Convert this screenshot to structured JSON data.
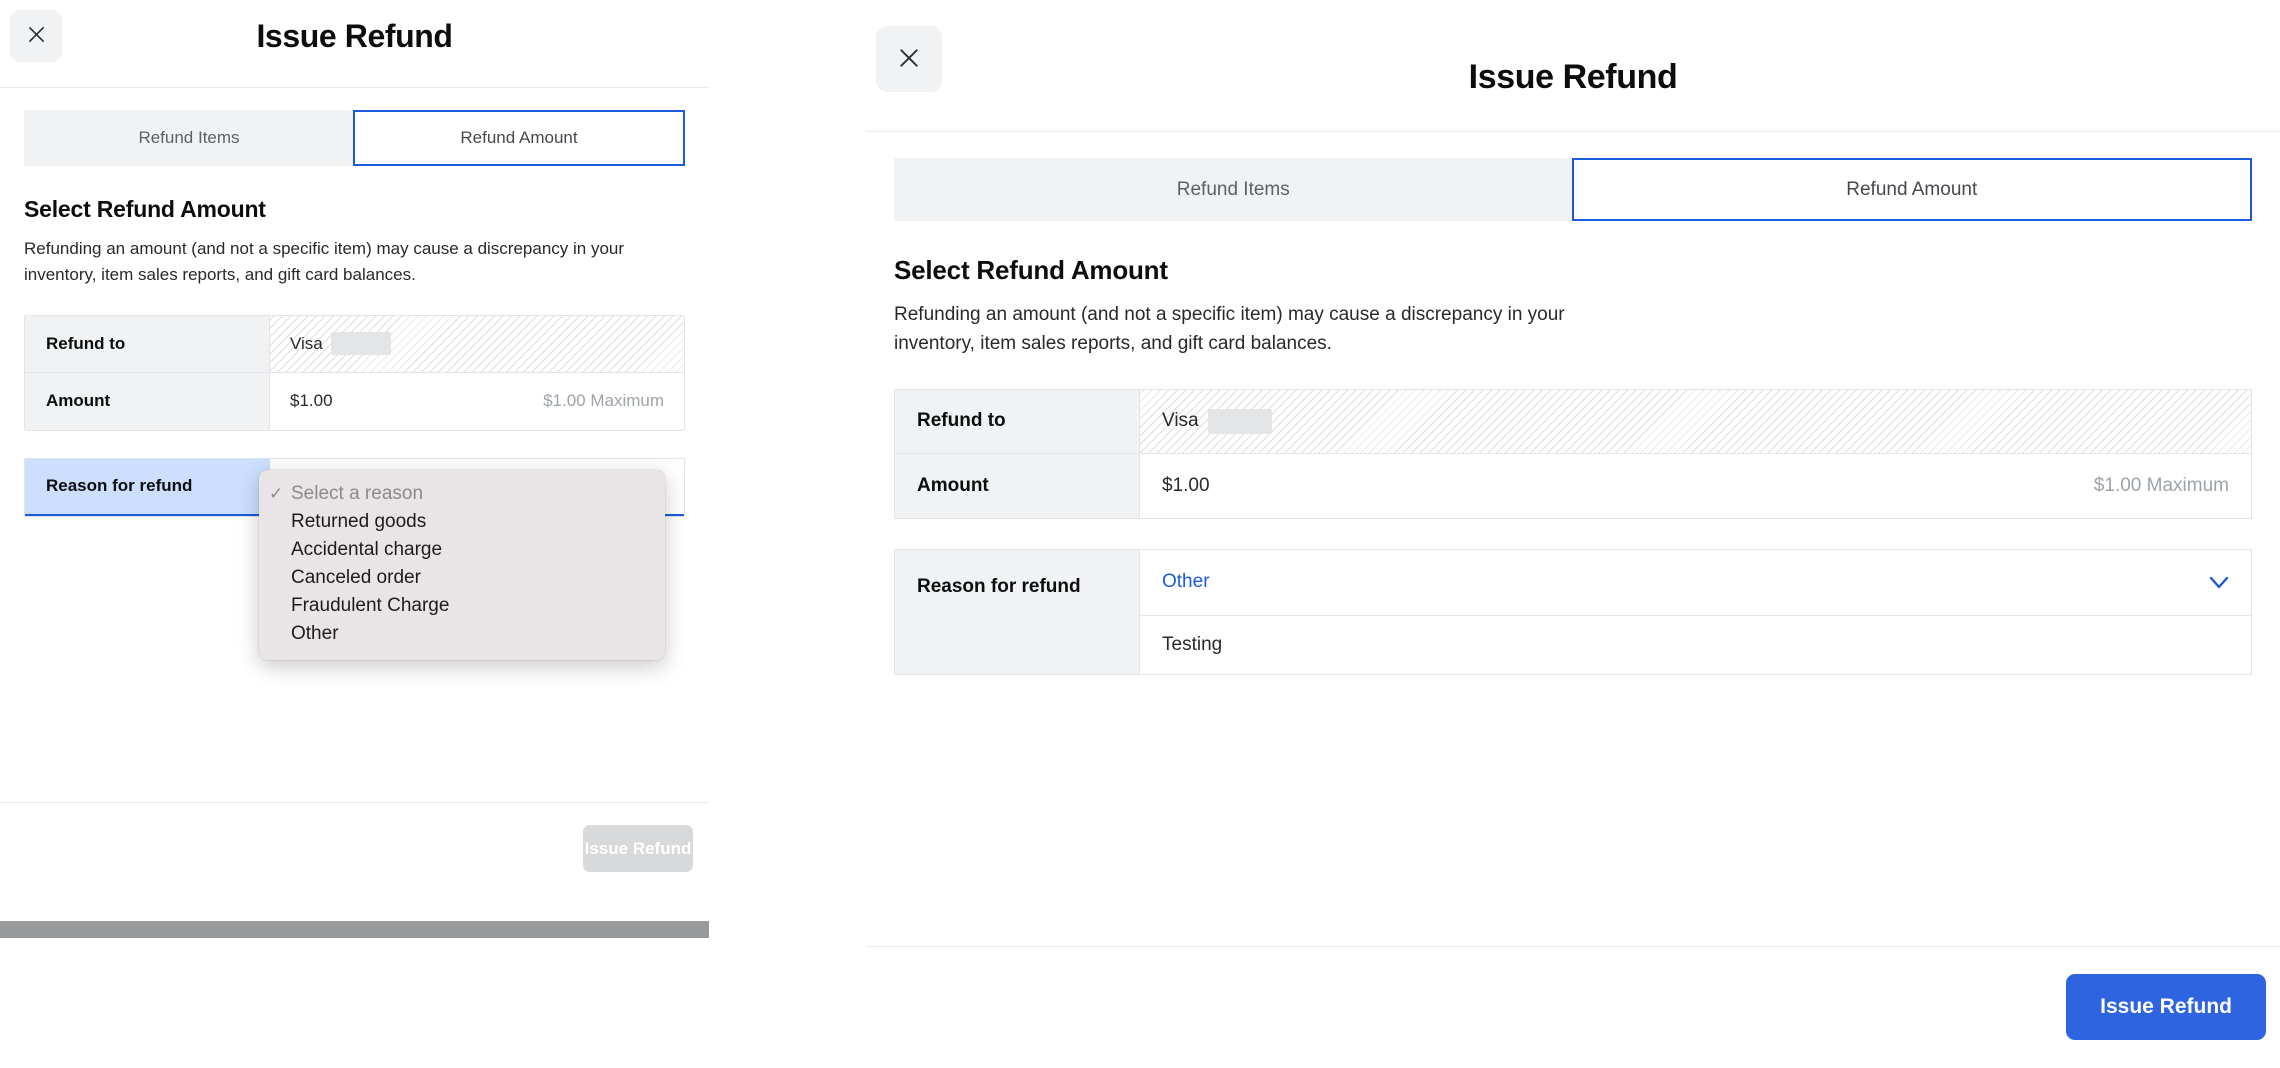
{
  "left_panel": {
    "title": "Issue Refund",
    "close_icon": "close-icon",
    "tabs": [
      {
        "label": "Refund Items",
        "active": false
      },
      {
        "label": "Refund Amount",
        "active": true
      }
    ],
    "section": {
      "heading": "Select Refund Amount",
      "description": "Refunding an amount (and not a specific item) may cause a discrepancy in your inventory, item sales reports, and gift card balances."
    },
    "rows": [
      {
        "label": "Refund to",
        "value": "Visa",
        "redacted": true,
        "hatched": true
      },
      {
        "label": "Amount",
        "value": "$1.00",
        "hint": "$1.00 Maximum",
        "hatched": false
      }
    ],
    "reason_row": {
      "label": "Reason for refund"
    },
    "footer_button": "Issue Refund"
  },
  "select_popup": {
    "options": [
      {
        "label": "Select a reason",
        "checked": true,
        "placeholder": true
      },
      {
        "label": "Returned goods",
        "checked": false,
        "placeholder": false
      },
      {
        "label": "Accidental charge",
        "checked": false,
        "placeholder": false
      },
      {
        "label": "Canceled order",
        "checked": false,
        "placeholder": false
      },
      {
        "label": "Fraudulent Charge",
        "checked": false,
        "placeholder": false
      },
      {
        "label": "Other",
        "checked": false,
        "placeholder": false
      }
    ],
    "check_glyph": "✓"
  },
  "right_panel": {
    "title": "Issue Refund",
    "close_icon": "close-icon",
    "tabs": [
      {
        "label": "Refund Items",
        "active": false
      },
      {
        "label": "Refund Amount",
        "active": true
      }
    ],
    "section": {
      "heading": "Select Refund Amount",
      "description": "Refunding an amount (and not a specific item) may cause a discrepancy in your inventory, item sales reports, and gift card balances."
    },
    "rows": [
      {
        "label": "Refund to",
        "value": "Visa",
        "redacted": true,
        "hatched": true
      },
      {
        "label": "Amount",
        "value": "$1.00",
        "hint": "$1.00 Maximum",
        "hatched": false
      }
    ],
    "reason_row": {
      "label": "Reason for refund",
      "selected_value": "Other",
      "note_value": "Testing",
      "chevron_icon": "chevron-down-icon"
    },
    "footer_button": "Issue Refund"
  },
  "colors": {
    "accent_blue": "#1b5bdb",
    "button_blue": "#2e64e0",
    "highlight_blue": "#ccdfff",
    "muted_gray": "#9ea3a8",
    "panel_gray": "#f1f2f3"
  }
}
